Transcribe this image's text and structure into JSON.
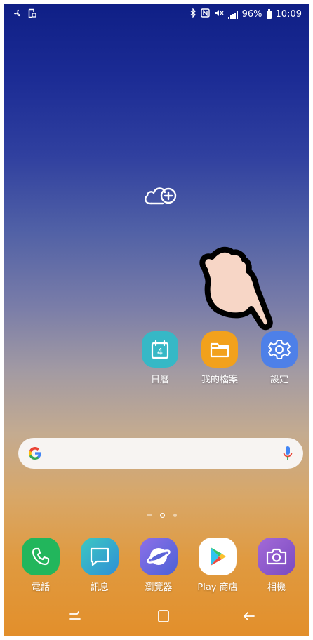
{
  "status_bar": {
    "left_icons": [
      "fan-icon",
      "screenshot-icon"
    ],
    "right_icons": [
      "bluetooth-icon",
      "nfc-icon",
      "mute-icon",
      "signal-icon"
    ],
    "battery": "96%",
    "time": "10:09"
  },
  "home": {
    "cloud_icon": "cloud-add-icon",
    "apps": [
      {
        "label": "日曆",
        "icon": "calendar-icon",
        "date": "4",
        "color": "#38b8c6"
      },
      {
        "label": "我的檔案",
        "icon": "folder-icon",
        "color": "#f0a020"
      },
      {
        "label": "設定",
        "icon": "gear-icon",
        "color": "#4c7fe6"
      }
    ]
  },
  "search": {
    "logo": "google-logo-icon",
    "mic": "mic-icon"
  },
  "pages": {
    "current": 2,
    "total": 3
  },
  "dock": [
    {
      "label": "電話",
      "icon": "phone-icon",
      "color": "#24b85e"
    },
    {
      "label": "訊息",
      "icon": "message-icon",
      "color": "#2bb6c8"
    },
    {
      "label": "瀏覽器",
      "icon": "browser-icon",
      "color": "#6a5ce0"
    },
    {
      "label": "Play 商店",
      "icon": "play-store-icon",
      "color": "#ffffff"
    },
    {
      "label": "相機",
      "icon": "camera-icon",
      "color": "#8a55c8"
    }
  ],
  "nav": [
    "recents-icon",
    "home-icon",
    "back-icon"
  ]
}
